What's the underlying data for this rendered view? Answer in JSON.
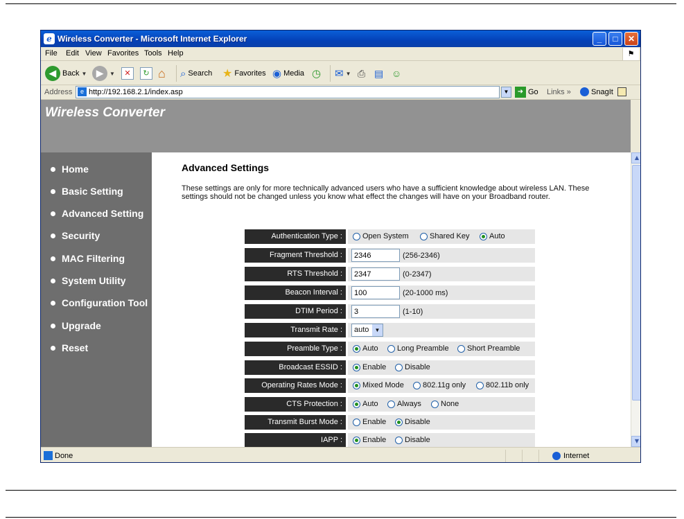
{
  "window": {
    "title": "Wireless Converter - Microsoft Internet Explorer"
  },
  "menu": [
    "File",
    "Edit",
    "View",
    "Favorites",
    "Tools",
    "Help"
  ],
  "toolbar": {
    "back": "Back",
    "search": "Search",
    "favorites": "Favorites",
    "media": "Media"
  },
  "address": {
    "label": "Address",
    "url": "http://192.168.2.1/index.asp",
    "go": "Go",
    "links": "Links",
    "snagit": "SnagIt"
  },
  "banner": {
    "title": "Wireless Converter"
  },
  "nav": [
    "Home",
    "Basic Setting",
    "Advanced Setting",
    "Security",
    "MAC Filtering",
    "System Utility",
    "Configuration Tool",
    "Upgrade",
    "Reset"
  ],
  "page": {
    "title": "Advanced Settings",
    "description": "These settings are only for more technically advanced users who have a sufficient knowledge about wireless LAN. These settings should not be changed unless you know what effect the changes will have on your Broadband router."
  },
  "settings": {
    "auth": {
      "label": "Authentication Type :",
      "options": [
        "Open System",
        "Shared Key",
        "Auto"
      ],
      "selected": "Auto"
    },
    "fragment": {
      "label": "Fragment Threshold :",
      "value": "2346",
      "hint": "(256-2346)"
    },
    "rts": {
      "label": "RTS Threshold :",
      "value": "2347",
      "hint": "(0-2347)"
    },
    "beacon": {
      "label": "Beacon Interval :",
      "value": "100",
      "hint": "(20-1000 ms)"
    },
    "dtim": {
      "label": "DTIM Period :",
      "value": "3",
      "hint": "(1-10)"
    },
    "txrate": {
      "label": "Transmit Rate :",
      "value": "auto"
    },
    "preamble": {
      "label": "Preamble Type :",
      "options": [
        "Auto",
        "Long Preamble",
        "Short Preamble"
      ],
      "selected": "Auto"
    },
    "essid": {
      "label": "Broadcast ESSID :",
      "options": [
        "Enable",
        "Disable"
      ],
      "selected": "Enable"
    },
    "oprates": {
      "label": "Operating Rates Mode :",
      "options": [
        "Mixed Mode",
        "802.11g only",
        "802.11b only"
      ],
      "selected": "Mixed Mode"
    },
    "cts": {
      "label": "CTS Protection :",
      "options": [
        "Auto",
        "Always",
        "None"
      ],
      "selected": "Auto"
    },
    "burst": {
      "label": "Transmit Burst Mode :",
      "options": [
        "Enable",
        "Disable"
      ],
      "selected": "Disable"
    },
    "iapp": {
      "label": "IAPP :",
      "options": [
        "Enable",
        "Disable"
      ],
      "selected": "Enable"
    }
  },
  "status": {
    "text": "Done",
    "zone": "Internet"
  }
}
